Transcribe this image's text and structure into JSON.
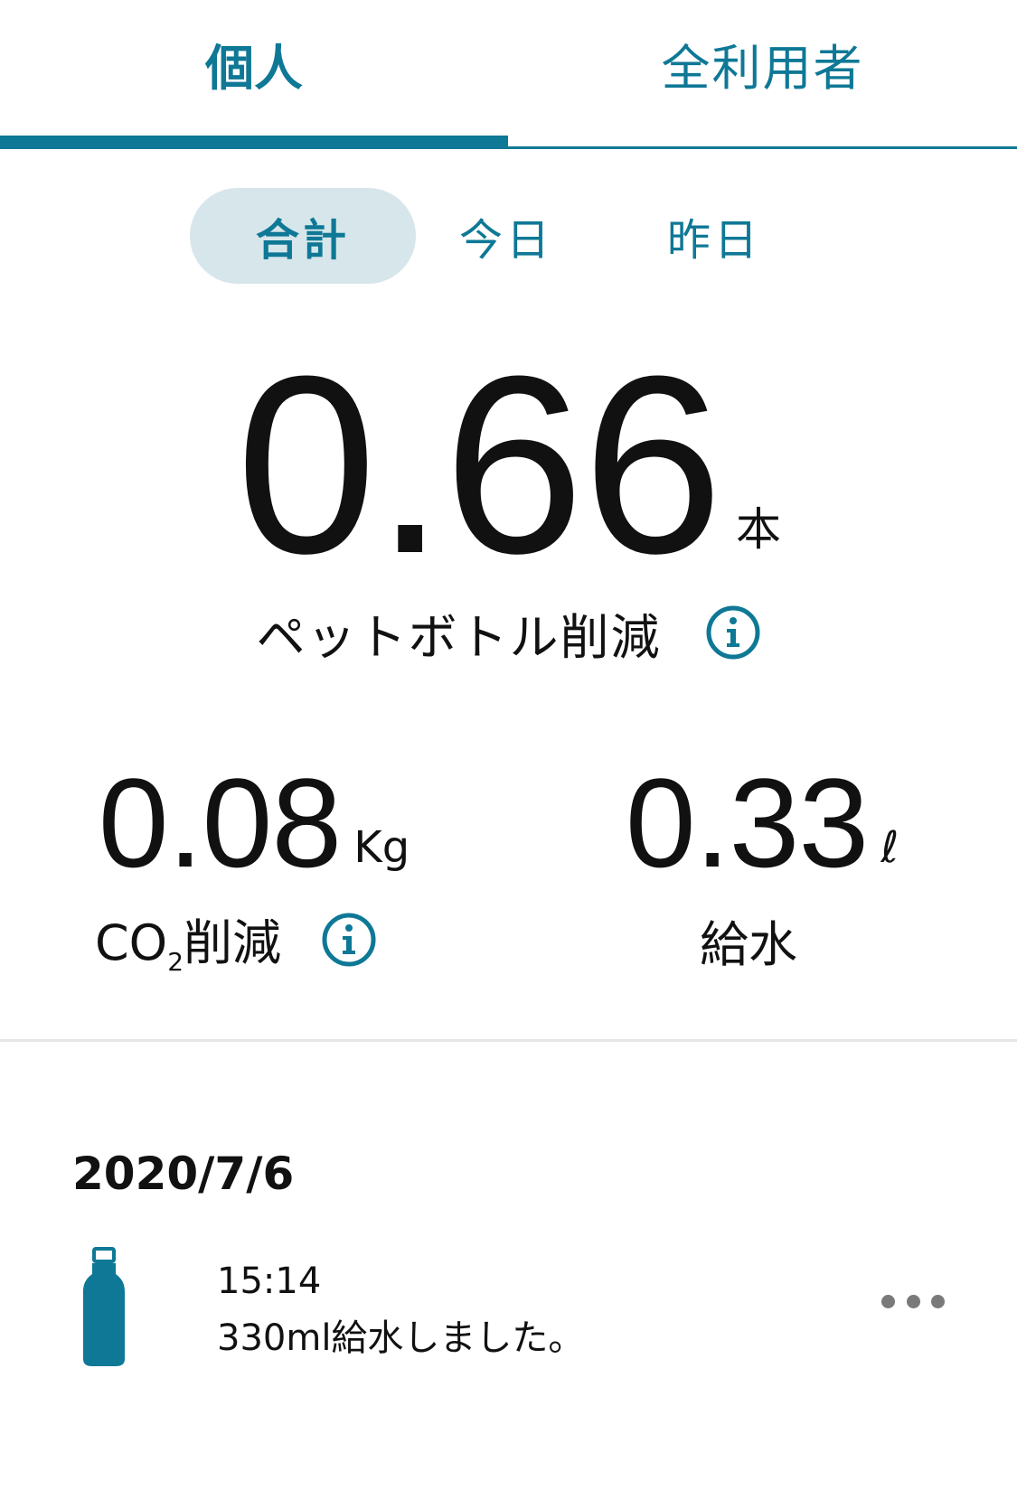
{
  "tabs": {
    "personal": "個人",
    "all_users": "全利用者",
    "active": "personal"
  },
  "period": {
    "total": "合計",
    "today": "今日",
    "yesterday": "昨日",
    "active": "total"
  },
  "main_metric": {
    "value": "0.66",
    "unit": "本",
    "label": "ペットボトル削減",
    "info_icon": "info-icon"
  },
  "co2_metric": {
    "value": "0.08",
    "unit": "Kg",
    "label_prefix": "CO",
    "label_sub": "2",
    "label_suffix": "削減",
    "info_icon": "info-icon"
  },
  "water_metric": {
    "value": "0.33",
    "unit": "ℓ",
    "label": "給水"
  },
  "history": {
    "date": "2020/7/6",
    "items": [
      {
        "icon": "bottle-icon",
        "time": "15:14",
        "text": "330ml給水しました。",
        "menu_icon": "more-icon"
      }
    ]
  },
  "colors": {
    "accent": "#0e7896",
    "accent_soft": "#d6e6ea",
    "text": "#111111",
    "divider": "#e6e6e6",
    "menu_dots": "#7a7a7a"
  }
}
